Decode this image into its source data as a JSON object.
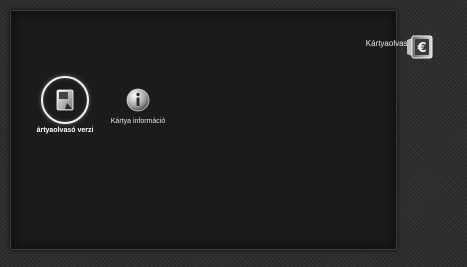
{
  "header": {
    "title": "Kártyaolvasó",
    "icon": "card-reader-euro-icon"
  },
  "menu": {
    "items": [
      {
        "label": "ártyaolvasó verzi",
        "icon": "card-document-icon",
        "selected": true
      },
      {
        "label": "Kártya információ",
        "icon": "info-icon",
        "selected": false
      }
    ]
  },
  "colors": {
    "background": "#2e2e2e",
    "panel": "#1b1b1b",
    "text": "#e8e8e8"
  }
}
